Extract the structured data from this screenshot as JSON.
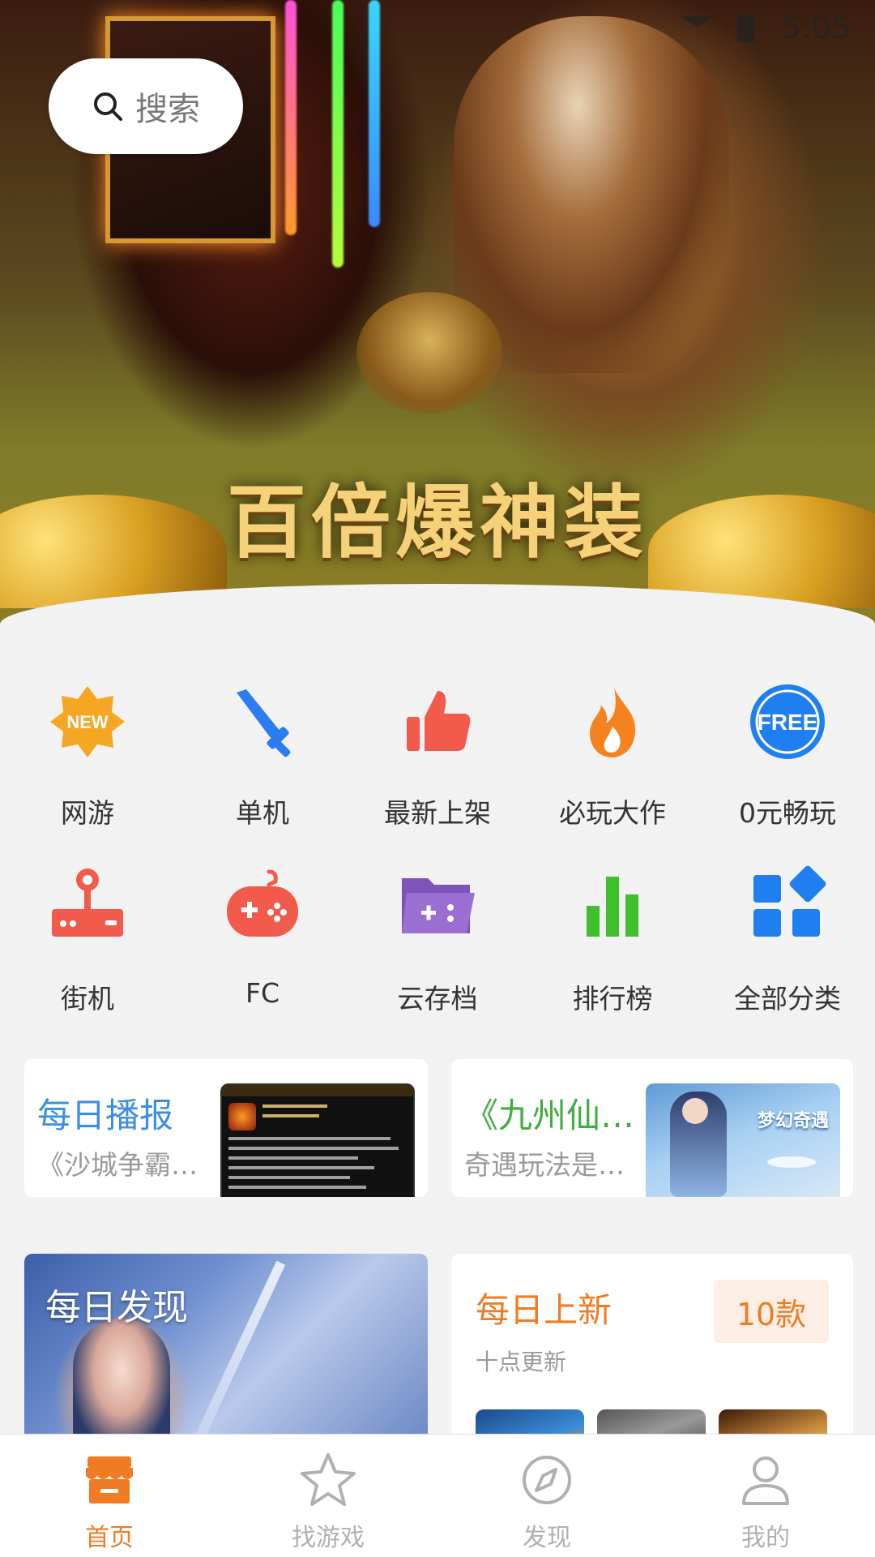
{
  "status_bar": {
    "time": "5:05"
  },
  "banner": {
    "title": "百倍爆神装"
  },
  "search": {
    "placeholder": "搜索"
  },
  "categories_row1": [
    {
      "label": "网游",
      "icon": "new-badge-icon",
      "color": "#f5a623",
      "badge_text": "NEW"
    },
    {
      "label": "单机",
      "icon": "sword-icon",
      "color": "#2a7cf0"
    },
    {
      "label": "最新上架",
      "icon": "thumbs-up-icon",
      "color": "#f25a4c"
    },
    {
      "label": "必玩大作",
      "icon": "flame-icon",
      "color": "#f5821f"
    },
    {
      "label": "0元畅玩",
      "icon": "free-icon",
      "color": "#1f7ff0",
      "badge_text": "FREE"
    }
  ],
  "categories_row2": [
    {
      "label": "街机",
      "icon": "joystick-icon",
      "color": "#f25a4c"
    },
    {
      "label": "FC",
      "icon": "gamepad-icon",
      "color": "#f25a4c"
    },
    {
      "label": "云存档",
      "icon": "cloud-folder-icon",
      "color": "#9a6fd1"
    },
    {
      "label": "排行榜",
      "icon": "bar-chart-icon",
      "color": "#3fbf2b"
    },
    {
      "label": "全部分类",
      "icon": "all-categories-icon",
      "color": "#1f7ff0"
    }
  ],
  "daily_report": {
    "title": "每日播报",
    "subtitle": "《沙城争霸…",
    "title_color": "#3a8ee6"
  },
  "article_card": {
    "title": "《九州仙…",
    "subtitle": "奇遇玩法是…",
    "title_color": "#3fae3f",
    "thumb_text": "梦幻奇遇"
  },
  "daily_discover": {
    "title": "每日发现"
  },
  "daily_new": {
    "title": "每日上新",
    "subtitle": "十点更新",
    "badge": "10款",
    "title_color": "#f07b22"
  },
  "tabs": [
    {
      "label": "首页",
      "icon": "home-store-icon",
      "active": true
    },
    {
      "label": "找游戏",
      "icon": "star-icon",
      "active": false
    },
    {
      "label": "发现",
      "icon": "compass-icon",
      "active": false
    },
    {
      "label": "我的",
      "icon": "user-icon",
      "active": false
    }
  ],
  "colors": {
    "accent": "#f07b22",
    "inactive": "#b0b0b0"
  }
}
